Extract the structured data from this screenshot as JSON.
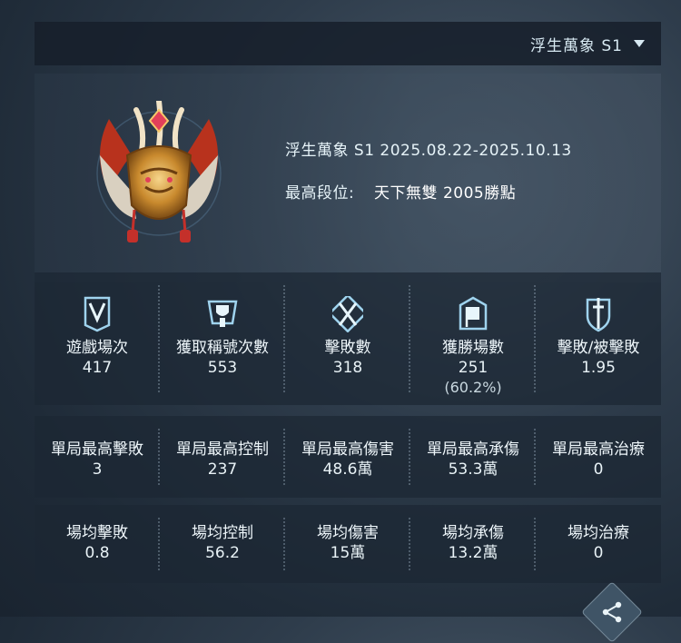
{
  "season_selector": {
    "label": "浮生萬象 S1",
    "icon": "chevron-down-icon"
  },
  "summary": {
    "season_range": "浮生萬象 S1 2025.08.22-2025.10.13",
    "highest_rank_prefix": "最高段位:",
    "highest_rank": "天下無雙 2005勝點",
    "emblem": "rank-emblem-icon"
  },
  "main_stats": [
    {
      "icon": "banner-icon",
      "label": "遊戲場次",
      "value": "417"
    },
    {
      "icon": "title-trophy-icon",
      "label": "獲取稱號次數",
      "value": "553"
    },
    {
      "icon": "crossed-swords-icon",
      "label": "擊敗數",
      "value": "318"
    },
    {
      "icon": "victory-flag-icon",
      "label": "獲勝場數",
      "value": "251",
      "sub": "(60.2%)"
    },
    {
      "icon": "sword-shield-icon",
      "label": "擊敗/被擊敗",
      "value": "1.95"
    }
  ],
  "single_best": [
    {
      "label": "單局最高擊敗",
      "value": "3"
    },
    {
      "label": "單局最高控制",
      "value": "237"
    },
    {
      "label": "單局最高傷害",
      "value": "48.6萬"
    },
    {
      "label": "單局最高承傷",
      "value": "53.3萬"
    },
    {
      "label": "單局最高治療",
      "value": "0"
    }
  ],
  "averages": [
    {
      "label": "場均擊敗",
      "value": "0.8"
    },
    {
      "label": "場均控制",
      "value": "56.2"
    },
    {
      "label": "場均傷害",
      "value": "15萬"
    },
    {
      "label": "場均承傷",
      "value": "13.2萬"
    },
    {
      "label": "場均治療",
      "value": "0"
    }
  ],
  "share": {
    "icon": "share-icon"
  }
}
